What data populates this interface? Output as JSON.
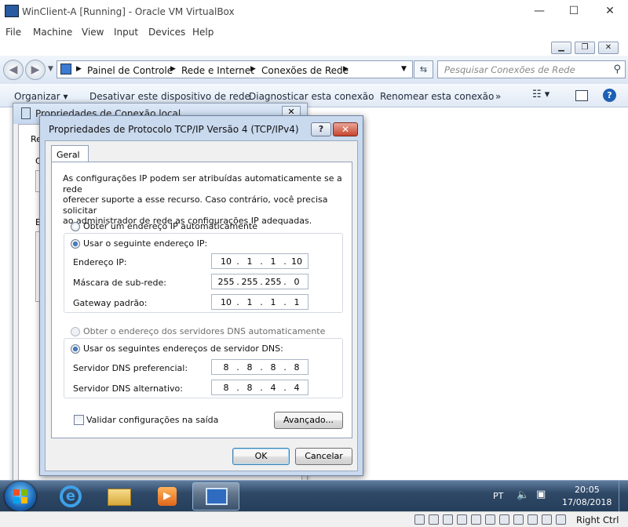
{
  "host": {
    "title": "WinClient-A [Running] - Oracle VM VirtualBox",
    "menu": [
      "File",
      "Machine",
      "View",
      "Input",
      "Devices",
      "Help"
    ],
    "controls": {
      "minimize": "—",
      "maximize": "☐",
      "close": "✕"
    },
    "right_ctrl": "Right Ctrl"
  },
  "explorer": {
    "breadcrumb": [
      "Painel de Controle",
      "Rede e Internet",
      "Conexões de Rede"
    ],
    "search_placeholder": "Pesquisar Conexões de Rede",
    "commands": [
      "Organizar ▾",
      "Desativar este dispositivo de rede",
      "Diagnosticar esta conexão",
      "Renomear esta conexão",
      "»"
    ]
  },
  "back_dialog": {
    "title": "Propriedades de Conexão local",
    "labels": [
      "Re",
      "C",
      "E"
    ]
  },
  "dialog": {
    "title": "Propriedades de Protocolo TCP/IP Versão 4 (TCP/IPv4)",
    "help": "?",
    "tab": "Geral",
    "description": [
      "As configurações IP podem ser atribuídas automaticamente se a rede",
      "oferecer suporte a esse recurso. Caso contrário, você precisa solicitar",
      "ao administrador de rede as configurações IP adequadas."
    ],
    "radio_auto_ip": "Obter um endereço IP automaticamente",
    "radio_manual_ip": "Usar o seguinte endereço IP:",
    "ip_label": "Endereço IP:",
    "ip": [
      "10",
      "1",
      "1",
      "10"
    ],
    "mask_label": "Máscara de sub-rede:",
    "mask": [
      "255",
      "255",
      "255",
      "0"
    ],
    "gateway_label": "Gateway padrão:",
    "gateway": [
      "10",
      "1",
      "1",
      "1"
    ],
    "radio_auto_dns": "Obter o endereço dos servidores DNS automaticamente",
    "radio_manual_dns": "Usar os seguintes endereços de servidor DNS:",
    "dns1_label": "Servidor DNS preferencial:",
    "dns1": [
      "8",
      "8",
      "8",
      "8"
    ],
    "dns2_label": "Servidor DNS alternativo:",
    "dns2": [
      "8",
      "8",
      "4",
      "4"
    ],
    "validate_label": "Validar configurações na saída",
    "advanced": "Avançado...",
    "ok": "OK",
    "cancel": "Cancelar"
  },
  "taskbar": {
    "lang": "PT",
    "time": "20:05",
    "date": "17/08/2018"
  }
}
